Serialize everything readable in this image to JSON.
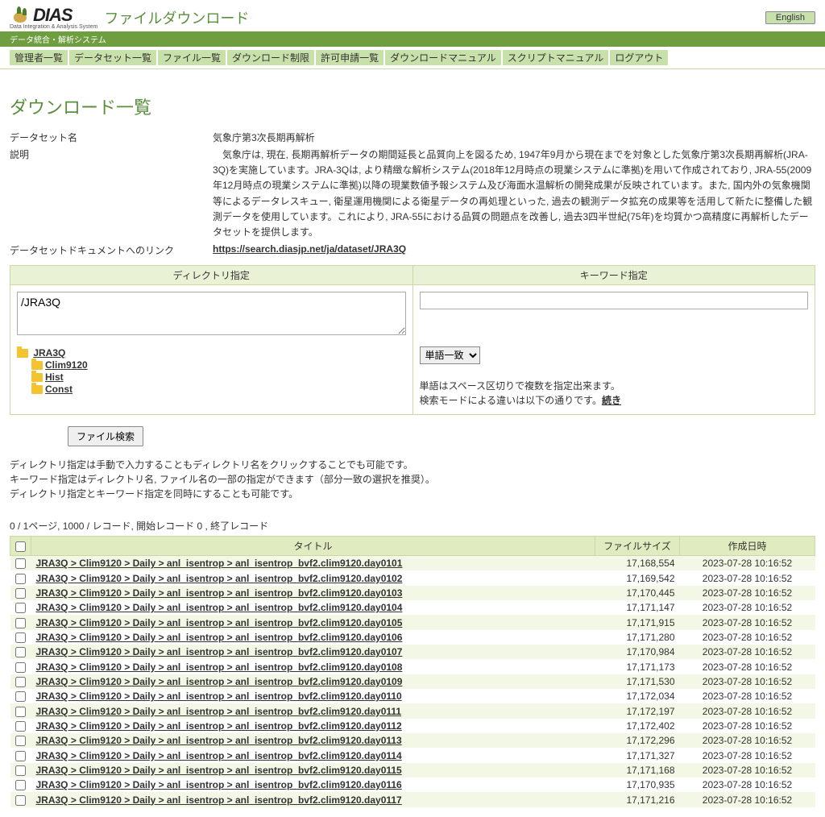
{
  "header": {
    "logo_text": "DIAS",
    "logo_sub": "Data Integration & Analysis System",
    "site_title": "ファイルダウンロード",
    "lang_btn": "English"
  },
  "subheader": "データ統合・解析システム",
  "nav": [
    "管理者一覧",
    "データセット一覧",
    "ファイル一覧",
    "ダウンロード制限",
    "許可申請一覧",
    "ダウンロードマニュアル",
    "スクリプトマニュアル",
    "ログアウト"
  ],
  "page_title": "ダウンロード一覧",
  "meta": {
    "dataset_label": "データセット名",
    "dataset_value": "気象庁第3次長期再解析",
    "desc_label": "説明",
    "desc_value": "　気象庁は, 現在, 長期再解析データの期間延長と品質向上を図るため, 1947年9月から現在までを対象とした気象庁第3次長期再解析(JRA-3Q)を実施しています。JRA-3Qは, より精緻な解析システム(2018年12月時点の現業システムに準拠)を用いて作成されており, JRA-55(2009年12月時点の現業システムに準拠)以降の現業数値予報システム及び海面水温解析の開発成果が反映されています。また, 国内外の気象機関等によるデータレスキュー, 衛星運用機関による衛星データの再処理といった, 過去の観測データ拡充の成果等を活用して新たに整備した観測データを使用しています。これにより, JRA-55における品質の問題点を改善し, 過去3四半世紀(75年)を均質かつ高精度に再解析したデータセットを提供します。",
    "doclink_label": "データセットドキュメントへのリンク",
    "doclink_value": "https://search.diasjp.net/ja/dataset/JRA3Q"
  },
  "panels": {
    "dir_title": "ディレクトリ指定",
    "kw_title": "キーワード指定",
    "dir_value": "/JRA3Q",
    "tree": {
      "root": "JRA3Q",
      "children": [
        "Clim9120",
        "Hist",
        "Const"
      ]
    },
    "kw_select": "単語一致",
    "kw_help1": "単語はスペース区切りで複数を指定出来ます。",
    "kw_help2_prefix": "検索モードによる違いは以下の通りです。",
    "kw_help2_link": "続き"
  },
  "search_btn": "ファイル検索",
  "notes": [
    "ディレクトリ指定は手動で入力することもディレクトリ名をクリックすることでも可能です。",
    "キーワード指定はディレクトリ名, ファイル名の一部の指定ができます（部分一致の選択を推奨）。",
    "ディレクトリ指定とキーワード指定を同時にすることも可能です。"
  ],
  "pager": "0 / 1ページ, 1000 / レコード, 開始レコード 0 , 終了レコード",
  "thead": {
    "title": "タイトル",
    "size": "ファイルサイズ",
    "date": "作成日時"
  },
  "rows": [
    {
      "title": "JRA3Q > Clim9120 > Daily > anl_isentrop > anl_isentrop_bvf2.clim9120.day0101",
      "size": "17,168,554",
      "date": "2023-07-28 10:16:52"
    },
    {
      "title": "JRA3Q > Clim9120 > Daily > anl_isentrop > anl_isentrop_bvf2.clim9120.day0102",
      "size": "17,169,542",
      "date": "2023-07-28 10:16:52"
    },
    {
      "title": "JRA3Q > Clim9120 > Daily > anl_isentrop > anl_isentrop_bvf2.clim9120.day0103",
      "size": "17,170,445",
      "date": "2023-07-28 10:16:52"
    },
    {
      "title": "JRA3Q > Clim9120 > Daily > anl_isentrop > anl_isentrop_bvf2.clim9120.day0104",
      "size": "17,171,147",
      "date": "2023-07-28 10:16:52"
    },
    {
      "title": "JRA3Q > Clim9120 > Daily > anl_isentrop > anl_isentrop_bvf2.clim9120.day0105",
      "size": "17,171,915",
      "date": "2023-07-28 10:16:52"
    },
    {
      "title": "JRA3Q > Clim9120 > Daily > anl_isentrop > anl_isentrop_bvf2.clim9120.day0106",
      "size": "17,171,280",
      "date": "2023-07-28 10:16:52"
    },
    {
      "title": "JRA3Q > Clim9120 > Daily > anl_isentrop > anl_isentrop_bvf2.clim9120.day0107",
      "size": "17,170,984",
      "date": "2023-07-28 10:16:52"
    },
    {
      "title": "JRA3Q > Clim9120 > Daily > anl_isentrop > anl_isentrop_bvf2.clim9120.day0108",
      "size": "17,171,173",
      "date": "2023-07-28 10:16:52"
    },
    {
      "title": "JRA3Q > Clim9120 > Daily > anl_isentrop > anl_isentrop_bvf2.clim9120.day0109",
      "size": "17,171,530",
      "date": "2023-07-28 10:16:52"
    },
    {
      "title": "JRA3Q > Clim9120 > Daily > anl_isentrop > anl_isentrop_bvf2.clim9120.day0110",
      "size": "17,172,034",
      "date": "2023-07-28 10:16:52"
    },
    {
      "title": "JRA3Q > Clim9120 > Daily > anl_isentrop > anl_isentrop_bvf2.clim9120.day0111",
      "size": "17,172,197",
      "date": "2023-07-28 10:16:52"
    },
    {
      "title": "JRA3Q > Clim9120 > Daily > anl_isentrop > anl_isentrop_bvf2.clim9120.day0112",
      "size": "17,172,402",
      "date": "2023-07-28 10:16:52"
    },
    {
      "title": "JRA3Q > Clim9120 > Daily > anl_isentrop > anl_isentrop_bvf2.clim9120.day0113",
      "size": "17,172,296",
      "date": "2023-07-28 10:16:52"
    },
    {
      "title": "JRA3Q > Clim9120 > Daily > anl_isentrop > anl_isentrop_bvf2.clim9120.day0114",
      "size": "17,171,327",
      "date": "2023-07-28 10:16:52"
    },
    {
      "title": "JRA3Q > Clim9120 > Daily > anl_isentrop > anl_isentrop_bvf2.clim9120.day0115",
      "size": "17,171,168",
      "date": "2023-07-28 10:16:52"
    },
    {
      "title": "JRA3Q > Clim9120 > Daily > anl_isentrop > anl_isentrop_bvf2.clim9120.day0116",
      "size": "17,170,935",
      "date": "2023-07-28 10:16:52"
    },
    {
      "title": "JRA3Q > Clim9120 > Daily > anl_isentrop > anl_isentrop_bvf2.clim9120.day0117",
      "size": "17,171,216",
      "date": "2023-07-28 10:16:52"
    }
  ]
}
